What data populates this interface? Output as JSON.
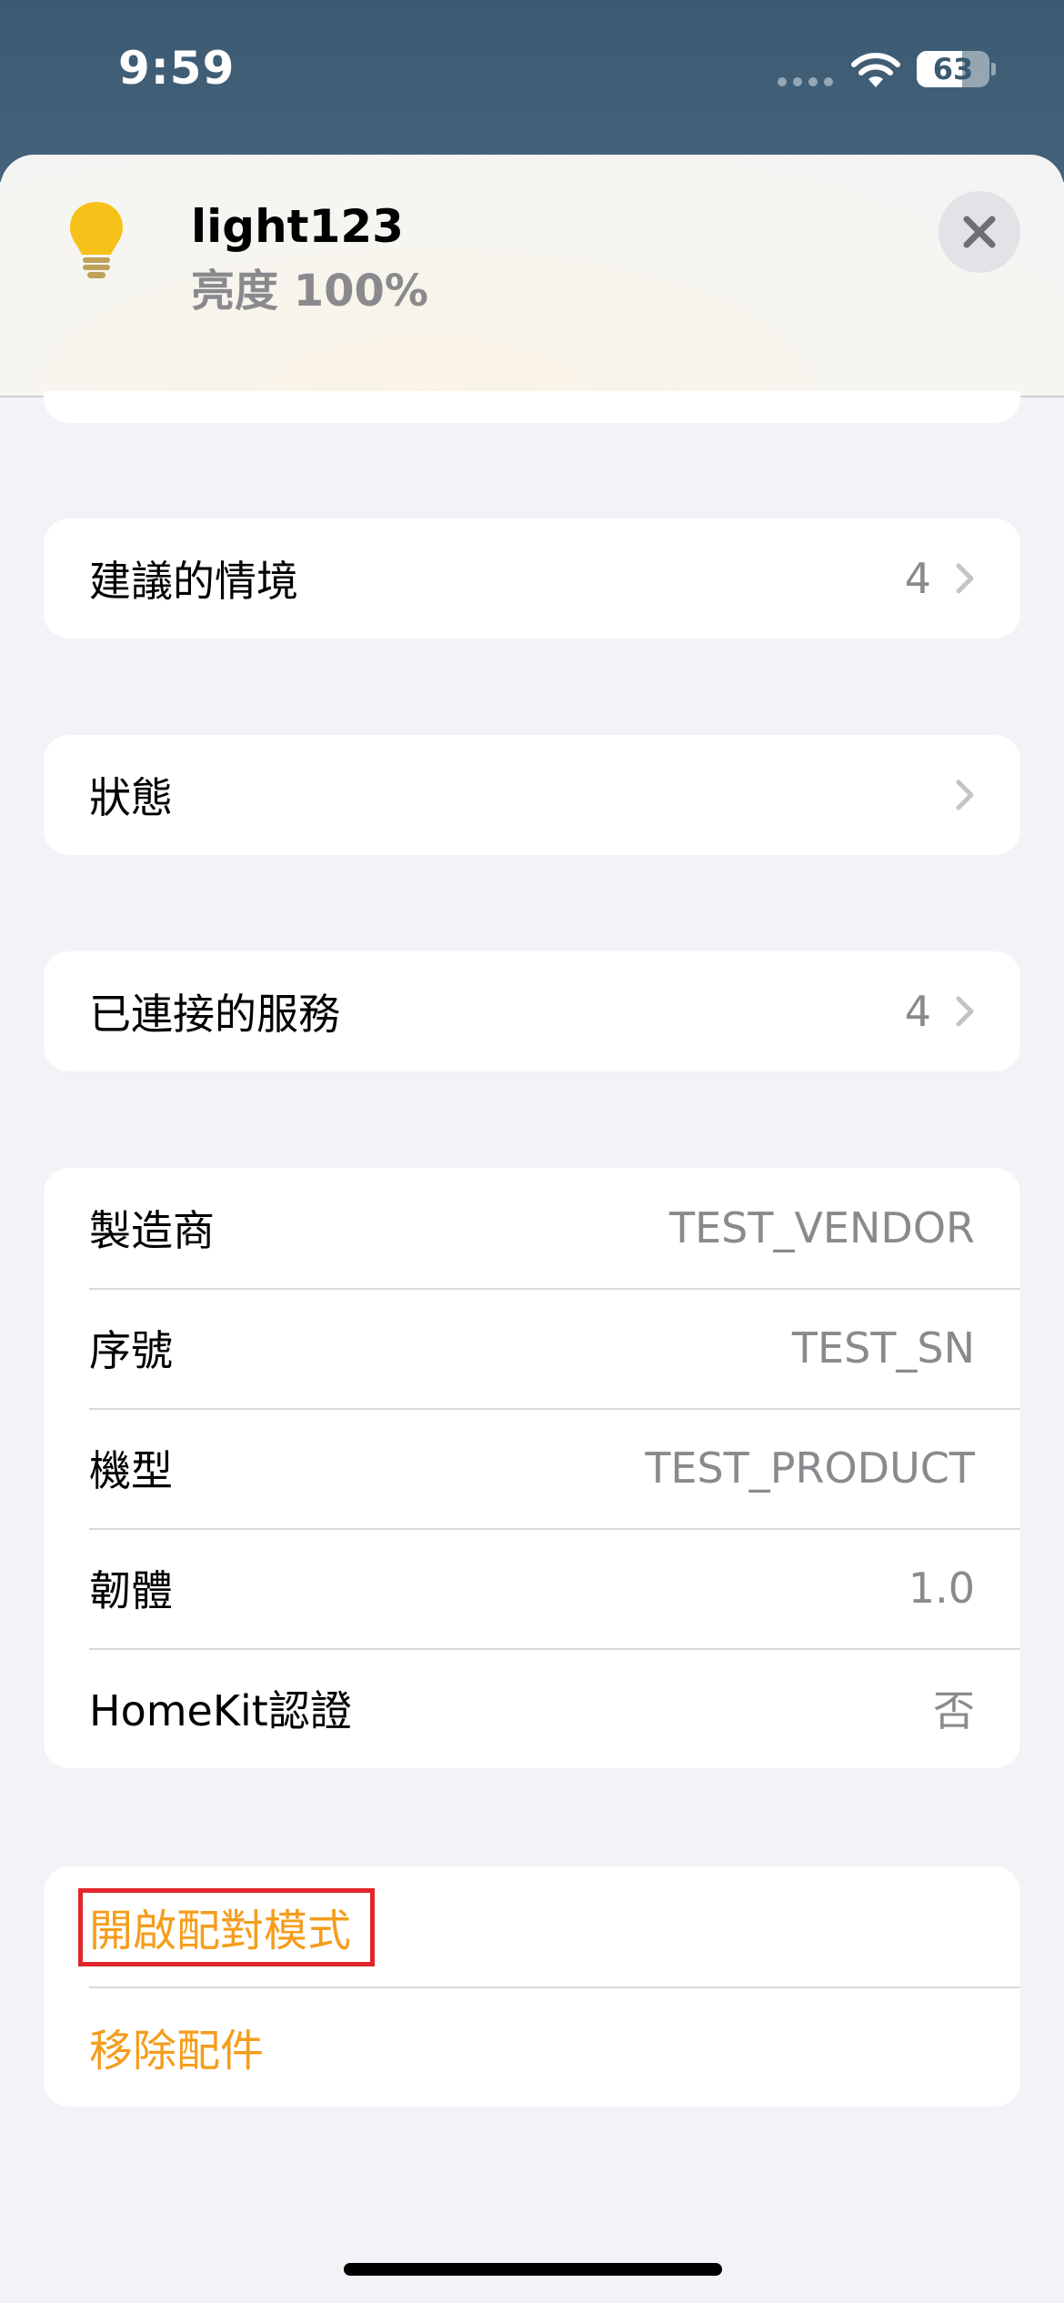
{
  "status_bar": {
    "time": "9:59",
    "battery": "63",
    "battery_fraction": 0.63
  },
  "header": {
    "device_name": "light123",
    "device_status": "亮度 100%",
    "bulb_color": "#f6c21a",
    "close_icon": "close-icon"
  },
  "sections": {
    "scenes": {
      "label": "建議的情境",
      "count": "4"
    },
    "status": {
      "label": "狀態"
    },
    "services": {
      "label": "已連接的服務",
      "count": "4"
    },
    "info": {
      "manufacturer": {
        "label": "製造商",
        "value": "TEST_VENDOR"
      },
      "serial": {
        "label": "序號",
        "value": "TEST_SN"
      },
      "model": {
        "label": "機型",
        "value": "TEST_PRODUCT"
      },
      "firmware": {
        "label": "韌體",
        "value": "1.0"
      },
      "homekit": {
        "label": "HomeKit認證",
        "value": "否"
      }
    },
    "actions": {
      "pairing_mode": "開啟配對模式",
      "remove_accessory": "移除配件",
      "accent_color": "#f59d1c"
    }
  }
}
